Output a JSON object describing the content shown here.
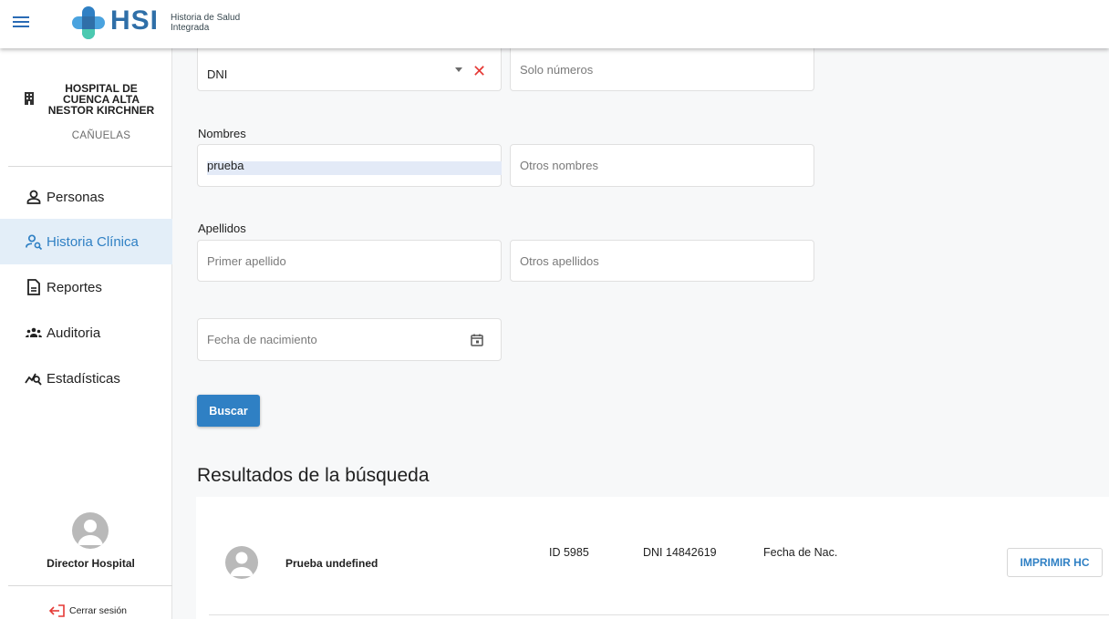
{
  "header": {
    "logo_text": "HSI",
    "logo_subtitle_line1": "Historia de Salud",
    "logo_subtitle_line2": "Integrada",
    "menu_icon": "hamburger-menu-icon"
  },
  "sidebar": {
    "institution_name": "HOSPITAL DE CUENCA ALTA NESTOR KIRCHNER",
    "institution_city": "CAÑUELAS",
    "items": [
      {
        "label": "Personas",
        "icon": "person-icon",
        "active": false
      },
      {
        "label": "Historia Clínica",
        "icon": "person-search-icon",
        "active": true
      },
      {
        "label": "Reportes",
        "icon": "document-icon",
        "active": false
      },
      {
        "label": "Auditoria",
        "icon": "group-icon",
        "active": false
      },
      {
        "label": "Estadísticas",
        "icon": "chart-search-icon",
        "active": false
      }
    ],
    "user_name": "Director Hospital",
    "logout_label": "Cerrar sesión"
  },
  "form": {
    "doc_type_value": "DNI",
    "doc_number_placeholder": "Solo números",
    "nombres_label": "Nombres",
    "primer_nombre_value": "prueba",
    "otros_nombres_placeholder": "Otros nombres",
    "apellidos_label": "Apellidos",
    "primer_apellido_placeholder": "Primer apellido",
    "otros_apellidos_placeholder": "Otros apellidos",
    "fecha_nacimiento_placeholder": "Fecha de nacimiento",
    "buscar_label": "Buscar"
  },
  "results": {
    "title": "Resultados de la búsqueda",
    "rows": [
      {
        "name": "Prueba undefined",
        "id": "ID 5985",
        "dni": "DNI 14842619",
        "fecha": "Fecha de Nac.",
        "print_label": "IMPRIMIR HC"
      }
    ]
  },
  "colors": {
    "accent": "#2f80c4",
    "active_bg": "#e3eef8",
    "clear": "#e53935"
  }
}
